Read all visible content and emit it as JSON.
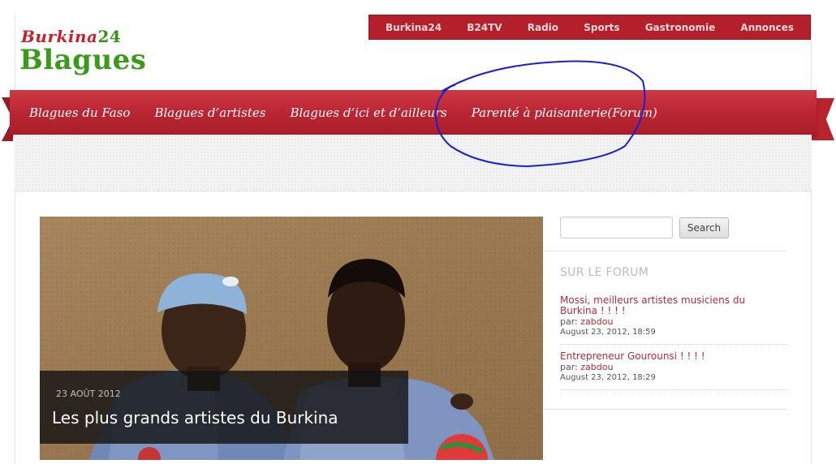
{
  "top_nav": {
    "items": [
      "Burkina24",
      "B24TV",
      "Radio",
      "Sports",
      "Gastronomie",
      "Annonces"
    ]
  },
  "logo": {
    "part1": "Burkina",
    "part2": "24",
    "main": "Blagues"
  },
  "main_nav": {
    "items": [
      "Blagues du Faso",
      "Blagues d’artistes",
      "Blagues d’ici et d’ailleurs",
      "Parenté à plaisanterie(Forum)"
    ]
  },
  "featured": {
    "date": "23 AOÛT 2012",
    "title": "Les plus grands artistes du Burkina"
  },
  "search": {
    "value": "",
    "button_label": "Search"
  },
  "forum": {
    "heading": "SUR LE FORUM",
    "by_label": "par:",
    "posts": [
      {
        "title": "Mossi, meilleurs artistes musiciens du Burkina ! ! ! !",
        "author": "zabdou",
        "date": "August 23, 2012, 18:59"
      },
      {
        "title": "Entrepreneur Gourounsi ! ! ! !",
        "author": "zabdou",
        "date": "August 23, 2012, 18:29"
      }
    ]
  },
  "colors": {
    "brand_red": "#b3202b",
    "brand_green": "#3a9a1a",
    "link_red": "#b72a35",
    "annotation_blue": "#1a1fd6"
  }
}
